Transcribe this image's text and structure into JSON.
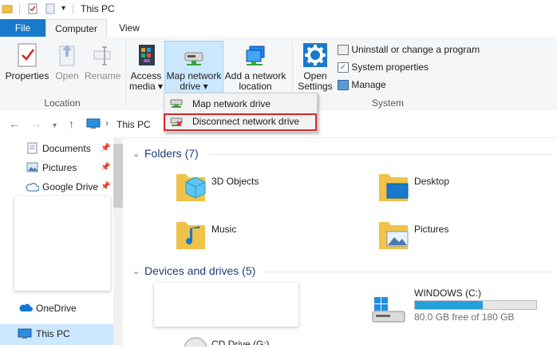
{
  "window": {
    "title": "This PC"
  },
  "tabs": {
    "file": "File",
    "computer": "Computer",
    "view": "View"
  },
  "ribbon": {
    "location": {
      "label": "Location",
      "properties": "Properties",
      "open": "Open",
      "rename": "Rename"
    },
    "network": {
      "access_media": [
        "Access",
        "media ▾"
      ],
      "map_network_drive": [
        "Map network",
        "drive ▾"
      ],
      "add_network_location": [
        "Add a network",
        "location"
      ]
    },
    "system": {
      "label": "System",
      "open_settings": [
        "Open",
        "Settings"
      ],
      "uninstall": "Uninstall or change a program",
      "system_properties": "System properties",
      "manage": "Manage"
    }
  },
  "address": {
    "breadcrumb_sep": "›",
    "location": "This PC"
  },
  "dropdown": {
    "items": [
      "Map network drive",
      "Disconnect network drive"
    ]
  },
  "nav": {
    "quick_access": [
      "Documents",
      "Pictures",
      "Google Drive"
    ],
    "onedrive": "OneDrive",
    "this_pc": "This PC"
  },
  "content": {
    "folders_title": "Folders (7)",
    "folders": [
      "3D Objects",
      "Desktop",
      "Music",
      "Pictures"
    ],
    "devices_title": "Devices and drives (5)",
    "drive": {
      "name": "WINDOWS (C:)",
      "free_text": "80.0 GB free of 180 GB",
      "used_fraction": 0.556
    },
    "partial_drive": "CD Drive (G:)"
  },
  "colors": {
    "accent": "#1979ca",
    "selection": "#cce8ff",
    "highlight_box": "#d9242c",
    "drive_fill": "#26a0da"
  }
}
